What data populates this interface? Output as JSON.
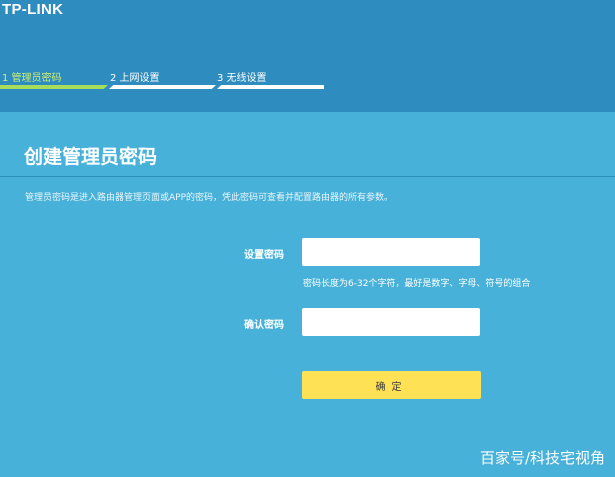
{
  "header": {
    "logo_text": "TP-LINK"
  },
  "steps": [
    {
      "label": "1 管理员密码",
      "active": true
    },
    {
      "label": "2 上网设置",
      "active": false
    },
    {
      "label": "3 无线设置",
      "active": false
    }
  ],
  "main": {
    "title": "创建管理员密码",
    "description": "管理员密码是进入路由器管理页面或APP的密码，凭此密码可查看并配置路由器的所有参数。",
    "set_password_label": "设置密码",
    "set_password_value": "",
    "password_hint": "密码长度为6-32个字符，最好是数字、字母、符号的组合",
    "confirm_password_label": "确认密码",
    "confirm_password_value": "",
    "confirm_button_label": "确定"
  },
  "watermark": "百家号/科技宅视角",
  "colors": {
    "header_bg": "#2f8cbe",
    "panel_bg": "#47b1d9",
    "active_step": "#a6dd5a",
    "button_bg": "#ffe155"
  }
}
